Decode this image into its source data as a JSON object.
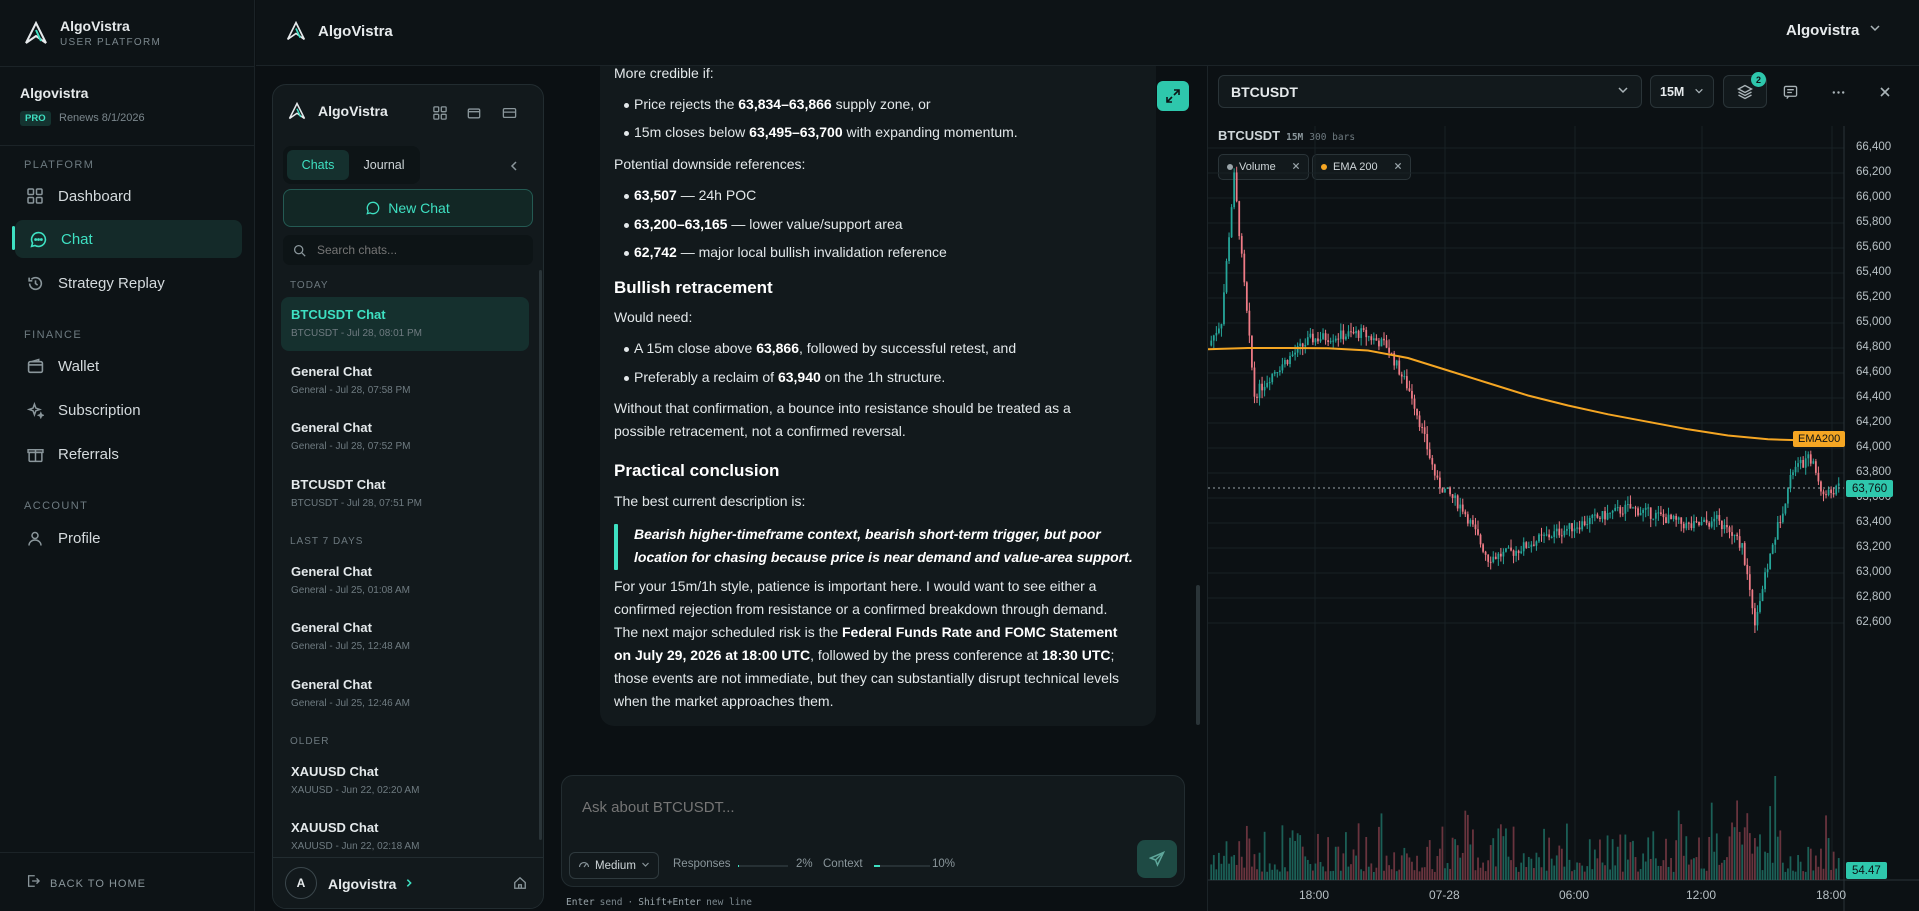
{
  "sidebar": {
    "brand_name": "AlgoVistra",
    "brand_sub": "USER PLATFORM",
    "user_name": "Algovistra",
    "plan_badge": "PRO",
    "renews": "Renews 8/1/2026",
    "sections": {
      "platform": "PLATFORM",
      "finance": "FINANCE",
      "account": "ACCOUNT"
    },
    "items": {
      "dashboard": "Dashboard",
      "chat": "Chat",
      "strategy_replay": "Strategy Replay",
      "wallet": "Wallet",
      "subscription": "Subscription",
      "referrals": "Referrals",
      "profile": "Profile"
    },
    "back_home": "BACK TO HOME",
    "accent": "#3ee0c2"
  },
  "topbar": {
    "brand_name": "AlgoVistra",
    "account_menu": "Algovistra"
  },
  "chat_panel": {
    "brand_name": "AlgoVistra",
    "tabs": [
      "Chats",
      "Journal"
    ],
    "new_chat": "New Chat",
    "search_placeholder": "Search chats...",
    "groups": {
      "today": "TODAY",
      "last7": "LAST 7 DAYS",
      "older": "OLDER"
    },
    "chats": [
      {
        "title": "BTCUSDT Chat",
        "sub": "BTCUSDT - Jul 28, 08:01 PM"
      },
      {
        "title": "General Chat",
        "sub": "General - Jul 28, 07:58 PM"
      },
      {
        "title": "General Chat",
        "sub": "General - Jul 28, 07:52 PM"
      },
      {
        "title": "BTCUSDT Chat",
        "sub": "BTCUSDT - Jul 28, 07:51 PM"
      },
      {
        "title": "General Chat",
        "sub": "General - Jul 25, 01:08 AM"
      },
      {
        "title": "General Chat",
        "sub": "General - Jul 25, 12:48 AM"
      },
      {
        "title": "General Chat",
        "sub": "General - Jul 25, 12:46 AM"
      },
      {
        "title": "XAUUSD Chat",
        "sub": "XAUUSD - Jun 22, 02:20 AM"
      },
      {
        "title": "XAUUSD Chat",
        "sub": "XAUUSD - Jun 22, 02:18 AM"
      }
    ],
    "footer_avatar": "A",
    "footer_user": "Algovistra"
  },
  "message": {
    "l1": "More credible if:",
    "b1a": "Price rejects the ",
    "b1b": "63,834–63,866",
    "b1c": " supply zone, or",
    "b2a": "15m closes below ",
    "b2b": "63,495–63,700",
    "b2c": " with expanding momentum.",
    "l2": "Potential downside references:",
    "b3a": "63,507",
    "b3b": " — 24h POC",
    "b4a": "63,200–63,165",
    "b4b": " — lower value/support area",
    "b5a": "62,742",
    "b5b": " — major local bullish invalidation reference",
    "h1": "Bullish retracement",
    "l3": "Would need:",
    "b6a": "A 15m close above ",
    "b6b": "63,866",
    "b6c": ", followed by successful retest, and",
    "b7a": "Preferably a reclaim of ",
    "b7b": "63,940",
    "b7c": " on the 1h structure.",
    "p1": "Without that confirmation, a bounce into resistance should be treated as a",
    "p2": "possible retracement, not a confirmed reversal.",
    "h2": "Practical conclusion",
    "l4": "The best current description is:",
    "q1": "Bearish higher-timeframe context, bearish short-term trigger, but poor",
    "q2": "location for chasing because price is near demand and value-area support.",
    "f1": "For your 15m/1h style, patience is important here. I would want to see either a",
    "f2": "confirmed rejection from resistance or a confirmed breakdown through demand.",
    "f3a": "The next major scheduled risk is the ",
    "f3b": "Federal Funds Rate and FOMC Statement",
    "f4a": "on July 29, 2026 at 18:00 UTC",
    "f4b": ", followed by the press conference at ",
    "f4c": "18:30 UTC",
    "f4d": ";",
    "f5": "those events are not immediate, but they can substantially disrupt technical levels",
    "f6": "when the market approaches them."
  },
  "composer": {
    "placeholder": "Ask about BTCUSDT...",
    "mode": "Medium",
    "responses_label": "Responses",
    "responses_value": "2%",
    "context_label": "Context",
    "context_value": "10%",
    "hint_enter": "Enter",
    "hint_send": "send",
    "hint_shift": "Shift+Enter",
    "hint_newline": "new line"
  },
  "chart_header": {
    "symbol": "BTCUSDT",
    "interval": "15M",
    "layers_badge": "2",
    "label_symbol": "BTCUSDT",
    "label_interval": "15M",
    "label_bars": "300 bars",
    "indicators": [
      "Volume",
      "EMA 200"
    ]
  },
  "chart_data": {
    "type": "candlestick",
    "symbol": "BTCUSDT",
    "interval": "15M",
    "yticks": [
      "66,400",
      "66,200",
      "66,000",
      "65,800",
      "65,600",
      "65,400",
      "65,200",
      "65,000",
      "64,800",
      "64,600",
      "64,400",
      "64,200",
      "64,000",
      "63,800",
      "63,600",
      "63,400",
      "63,200",
      "63,000",
      "62,800",
      "62,600"
    ],
    "xticks": [
      "18:00",
      "07-28",
      "06:00",
      "12:00",
      "18:00"
    ],
    "ylim": [
      62480,
      66480
    ],
    "ema_label": "EMA200",
    "ema_value": 64150,
    "last_price_label": "63,760",
    "last_price": 63760,
    "volume_label": "54.47",
    "ema_points": [
      64870,
      64880,
      64880,
      64878,
      64860,
      64800,
      64700,
      64600,
      64500,
      64420,
      64350,
      64290,
      64230,
      64180,
      64150,
      64140
    ],
    "up_color": "#26a69a",
    "down_color": "#ef7b86",
    "ema_color": "#f5a623"
  }
}
